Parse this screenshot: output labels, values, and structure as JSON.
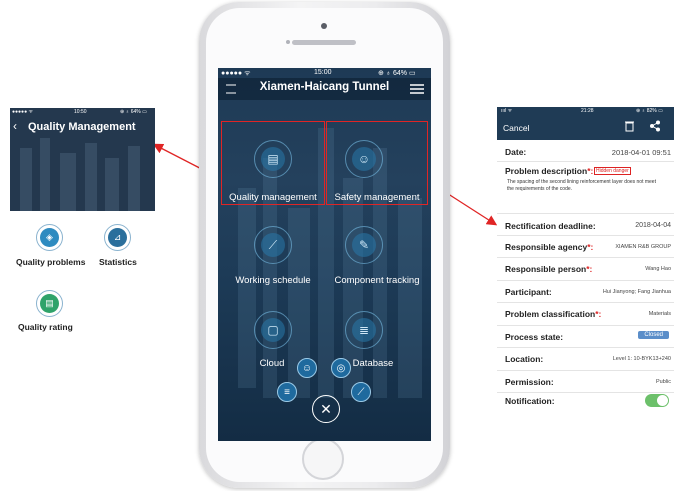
{
  "phone": {
    "status_carrier": "●●●●● ᯤ",
    "status_time": "15:00",
    "status_battery": "⊕ ♁ 64% ▭",
    "app_title": "Xiamen-Haicang Tunnel",
    "tiles": [
      {
        "label": "Quality management",
        "icon": "quality-icon"
      },
      {
        "label": "Safety management",
        "icon": "helmet-icon"
      },
      {
        "label": "Working schedule",
        "icon": "chart-icon"
      },
      {
        "label": "Component tracking",
        "icon": "tracking-icon"
      },
      {
        "label": "Cloud",
        "icon": "folder-icon"
      },
      {
        "label": "Database",
        "icon": "database-icon"
      }
    ],
    "fab_icons": [
      "user-icon",
      "camera-icon",
      "list-icon",
      "stats-icon"
    ],
    "close_glyph": "✕"
  },
  "left_panel": {
    "status_left": "●●●●● ᯤ",
    "status_time": "10:50",
    "status_right": "⊕ ♁ 64% ▭",
    "back_glyph": "‹",
    "title": "Quality Management",
    "items": [
      {
        "label": "Quality problems",
        "icon": "shield-icon",
        "color": "#2e8bc0"
      },
      {
        "label": "Statistics",
        "icon": "chart-icon",
        "color": "#2a6f9c"
      },
      {
        "label": "Quality rating",
        "icon": "rating-icon",
        "color": "#2fa36a"
      }
    ]
  },
  "right_panel": {
    "status_left": "ıııl ᯤ",
    "status_time": "21:28",
    "status_right": "⊕ ♁ 82% ▭",
    "cancel": "Cancel",
    "date_label": "Date:",
    "date_value": "2018-04-01 09:51",
    "problem_label": "Problem description",
    "problem_tag": "Hidden danger",
    "problem_text": "The spacing of the second lining reinforcement layer does not meet the requirements of the code.",
    "rows": [
      {
        "label": "Rectification deadline:",
        "value": "2018-04-04",
        "required": false
      },
      {
        "label": "Responsible agency",
        "value": "XIAMEN R&B GROUP",
        "required": true
      },
      {
        "label": "Responsible person",
        "value": "Wang Hao",
        "required": true
      },
      {
        "label": "Participant:",
        "value": "Hui Jianyong; Fang Jianhua",
        "required": false
      },
      {
        "label": "Problem classification",
        "value": "Materials",
        "required": true
      },
      {
        "label": "Process state:",
        "value": "Closed",
        "required": false
      },
      {
        "label": "Location:",
        "value": "Level 1: 10-BYK13+240",
        "required": false
      },
      {
        "label": "Permission:",
        "value": "Public",
        "required": false
      },
      {
        "label": "Notification:",
        "value": "",
        "required": false
      }
    ],
    "required_mark": "*:"
  }
}
